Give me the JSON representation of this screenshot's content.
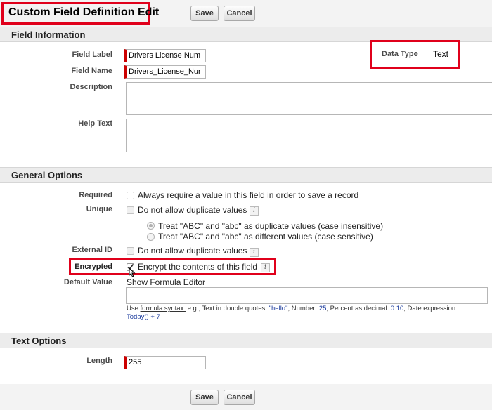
{
  "header": {
    "title": "Custom Field Definition Edit",
    "save_label": "Save",
    "cancel_label": "Cancel"
  },
  "field_information": {
    "heading": "Field Information",
    "field_label": {
      "label": "Field Label",
      "value": "Drivers License Num"
    },
    "field_name": {
      "label": "Field Name",
      "value": "Drivers_License_Nur"
    },
    "data_type": {
      "label": "Data Type",
      "value": "Text"
    },
    "description": {
      "label": "Description",
      "value": ""
    },
    "help_text": {
      "label": "Help Text",
      "value": ""
    }
  },
  "general_options": {
    "heading": "General Options",
    "required": {
      "label": "Required",
      "text": "Always require a value in this field in order to save a record",
      "checked": false
    },
    "unique": {
      "label": "Unique",
      "text": "Do not allow duplicate values",
      "checked": false,
      "options": [
        {
          "text": "Treat \"ABC\" and \"abc\" as duplicate values (case insensitive)",
          "selected": true
        },
        {
          "text": "Treat \"ABC\" and \"abc\" as different values (case sensitive)",
          "selected": false
        }
      ]
    },
    "external_id": {
      "label": "External ID",
      "text": "Do not allow duplicate values",
      "checked": false
    },
    "encrypted": {
      "label": "Encrypted",
      "text": "Encrypt the contents of this field",
      "checked": true
    },
    "default_value": {
      "label": "Default Value",
      "link": "Show Formula Editor",
      "value": "",
      "hint": {
        "use": "Use ",
        "syntax_link": "formula syntax:",
        "p1": " e.g., Text in double quotes: ",
        "q1": "\"hello\"",
        "p2": ", Number: ",
        "q2": "25",
        "p3": ", Percent as decimal: ",
        "q3": "0.10",
        "p4": ", Date expression:",
        "q4": "Today() + 7"
      }
    }
  },
  "text_options": {
    "heading": "Text Options",
    "length": {
      "label": "Length",
      "value": "255"
    }
  },
  "footer": {
    "save_label": "Save",
    "cancel_label": "Cancel"
  },
  "colors": {
    "highlight": "#e0001b",
    "required_bar": "#cc0000",
    "section_bg": "#ececec",
    "link_blue": "#1a3a9c"
  }
}
